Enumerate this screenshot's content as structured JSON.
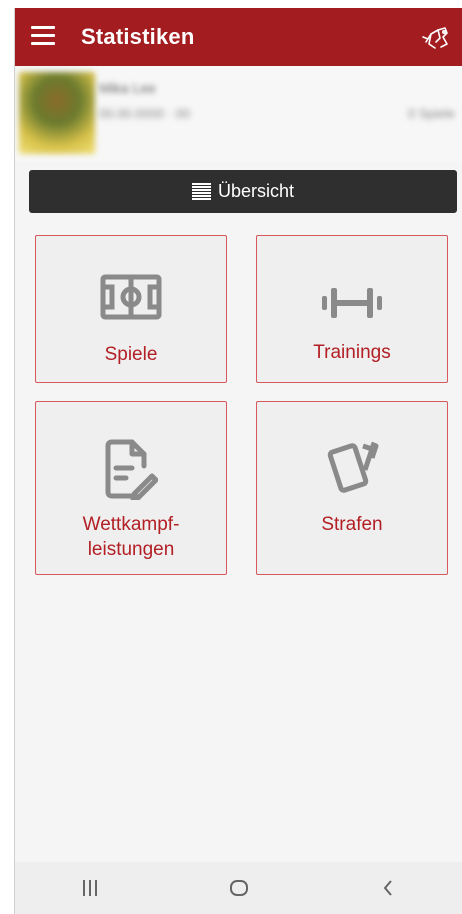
{
  "appbar": {
    "title": "Statistiken",
    "menu_icon": "hamburger-menu-icon",
    "logo_icon": "swiss-sport-logo-icon",
    "background": "#a31d20"
  },
  "profile": {
    "name": "Mika Lee",
    "date": "00.00.0000 · 00",
    "meta": "0 Spiele"
  },
  "overview_button": {
    "label": "Übersicht",
    "icon": "list-icon",
    "background": "#2f2f2f"
  },
  "tiles": [
    {
      "label": "Spiele",
      "icon": "soccer-field-icon"
    },
    {
      "label": "Trainings",
      "icon": "dumbbell-icon"
    },
    {
      "label_line1": "Wettkampf-",
      "label_line2": "leistungen",
      "icon": "document-edit-icon"
    },
    {
      "label": "Strafen",
      "icon": "penalty-cards-icon"
    }
  ],
  "tile_style": {
    "accent": "#b21f24",
    "border": "#d9585c",
    "icon_color": "#8a8a8a"
  },
  "navbar": {
    "buttons": [
      "recent-apps-icon",
      "home-icon",
      "back-icon"
    ]
  }
}
